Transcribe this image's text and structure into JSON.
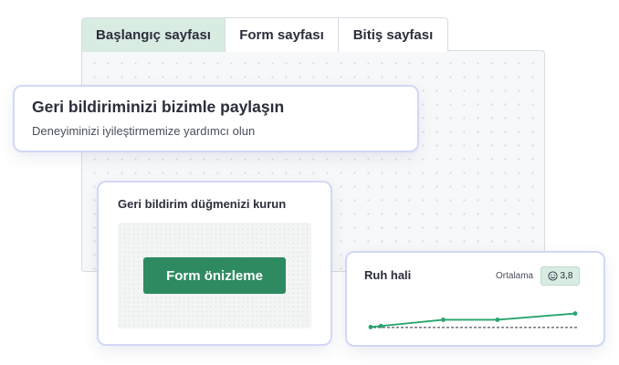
{
  "tabs": [
    {
      "label": "Başlangıç sayfası",
      "active": true
    },
    {
      "label": "Form sayfası",
      "active": false
    },
    {
      "label": "Bitiş sayfası",
      "active": false
    }
  ],
  "intro_card": {
    "title": "Geri bildiriminizi bizimle paylaşın",
    "subtitle": "Deneyiminizi iyileştirmemize yardımcı olun"
  },
  "button_card": {
    "title": "Geri bildirim düğmenizi kurun",
    "button_label": "Form önizleme"
  },
  "mood_card": {
    "title": "Ruh hali",
    "average_label": "Ortalama",
    "average_value": "3,8",
    "average_icon": "smiley-icon"
  },
  "chart_data": {
    "type": "line",
    "title": "Ruh hali",
    "xlabel": "",
    "ylabel": "",
    "values": [
      3.0,
      3.05,
      3.35,
      3.35,
      3.65
    ],
    "reference_line": 3.0,
    "ylim": [
      2.8,
      4.2
    ],
    "grid": false
  },
  "colors": {
    "accent": "#2e8b61",
    "accent_light": "#d8ece2",
    "line": "#27a56b"
  }
}
